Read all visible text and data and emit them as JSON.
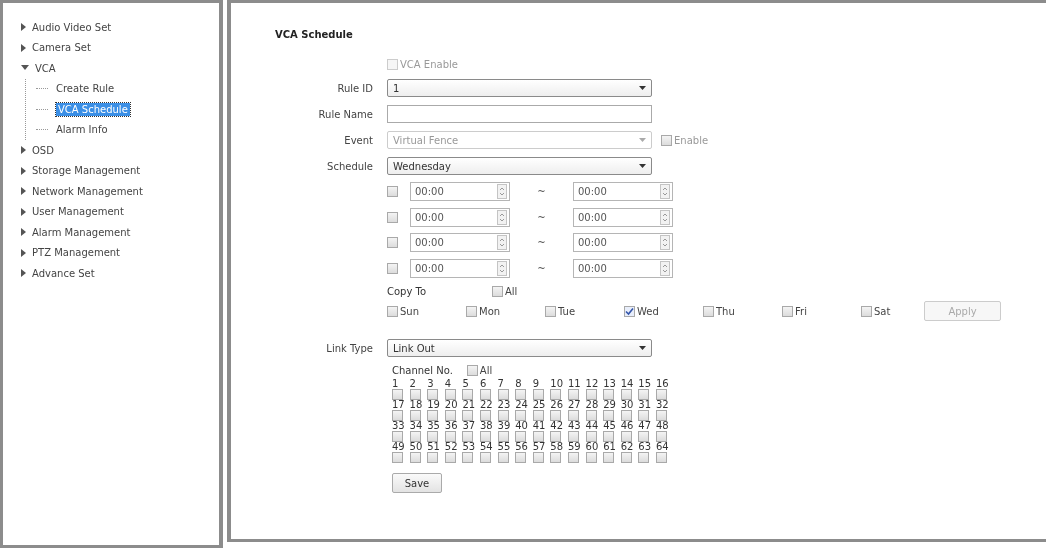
{
  "sidebar": {
    "items": [
      {
        "label": "Audio Video Set",
        "expanded": false
      },
      {
        "label": "Camera Set",
        "expanded": false
      },
      {
        "label": "VCA",
        "expanded": true,
        "children": [
          {
            "label": "Create Rule",
            "selected": false
          },
          {
            "label": "VCA Schedule",
            "selected": true
          },
          {
            "label": "Alarm Info",
            "selected": false
          }
        ]
      },
      {
        "label": "OSD",
        "expanded": false
      },
      {
        "label": "Storage Management",
        "expanded": false
      },
      {
        "label": "Network Management",
        "expanded": false
      },
      {
        "label": "User Management",
        "expanded": false
      },
      {
        "label": "Alarm Management",
        "expanded": false
      },
      {
        "label": "PTZ Management",
        "expanded": false
      },
      {
        "label": "Advance Set",
        "expanded": false
      }
    ]
  },
  "page": {
    "title": "VCA Schedule",
    "vca_enable": {
      "label": "VCA Enable",
      "checked": false,
      "disabled": true
    },
    "rule_id": {
      "label": "Rule ID",
      "value": "1"
    },
    "rule_name": {
      "label": "Rule Name"
    },
    "event": {
      "label": "Event",
      "value": "Virtual Fence",
      "disabled": true,
      "enable": {
        "label": "Enable",
        "checked": false
      }
    },
    "schedule": {
      "label": "Schedule",
      "value": "Wednesday"
    },
    "time_rows": [
      {
        "checked": false,
        "start": "00:00",
        "separator": "~",
        "end": "00:00"
      },
      {
        "checked": false,
        "start": "00:00",
        "separator": "~",
        "end": "00:00"
      },
      {
        "checked": false,
        "start": "00:00",
        "separator": "~",
        "end": "00:00"
      },
      {
        "checked": false,
        "start": "00:00",
        "separator": "~",
        "end": "00:00"
      }
    ],
    "copy_to": {
      "label": "Copy To",
      "all": {
        "label": "All",
        "checked": false
      },
      "days": [
        {
          "label": "Sun",
          "checked": false
        },
        {
          "label": "Mon",
          "checked": false
        },
        {
          "label": "Tue",
          "checked": false
        },
        {
          "label": "Wed",
          "checked": true
        },
        {
          "label": "Thu",
          "checked": false
        },
        {
          "label": "Fri",
          "checked": false
        },
        {
          "label": "Sat",
          "checked": false
        }
      ],
      "apply": {
        "label": "Apply",
        "disabled": true
      }
    },
    "link_type": {
      "label": "Link Type",
      "value": "Link Out"
    },
    "channels": {
      "label": "Channel No.",
      "all": {
        "label": "All",
        "checked": false
      },
      "items": [
        {
          "label": "1",
          "checked": false
        },
        {
          "label": "2",
          "checked": false
        },
        {
          "label": "3",
          "checked": false
        },
        {
          "label": "4",
          "checked": false
        },
        {
          "label": "5",
          "checked": false
        },
        {
          "label": "6",
          "checked": false
        },
        {
          "label": "7",
          "checked": false
        },
        {
          "label": "8",
          "checked": false
        },
        {
          "label": "9",
          "checked": false
        },
        {
          "label": "10",
          "checked": false
        },
        {
          "label": "11",
          "checked": false
        },
        {
          "label": "12",
          "checked": false
        },
        {
          "label": "13",
          "checked": false
        },
        {
          "label": "14",
          "checked": false
        },
        {
          "label": "15",
          "checked": false
        },
        {
          "label": "16",
          "checked": false
        },
        {
          "label": "17",
          "checked": false
        },
        {
          "label": "18",
          "checked": false
        },
        {
          "label": "19",
          "checked": false
        },
        {
          "label": "20",
          "checked": false
        },
        {
          "label": "21",
          "checked": false
        },
        {
          "label": "22",
          "checked": false
        },
        {
          "label": "23",
          "checked": false
        },
        {
          "label": "24",
          "checked": false
        },
        {
          "label": "25",
          "checked": false
        },
        {
          "label": "26",
          "checked": false
        },
        {
          "label": "27",
          "checked": false
        },
        {
          "label": "28",
          "checked": false
        },
        {
          "label": "29",
          "checked": false
        },
        {
          "label": "30",
          "checked": false
        },
        {
          "label": "31",
          "checked": false
        },
        {
          "label": "32",
          "checked": false
        },
        {
          "label": "33",
          "checked": false
        },
        {
          "label": "34",
          "checked": false
        },
        {
          "label": "35",
          "checked": false
        },
        {
          "label": "36",
          "checked": false
        },
        {
          "label": "37",
          "checked": false
        },
        {
          "label": "38",
          "checked": false
        },
        {
          "label": "39",
          "checked": false
        },
        {
          "label": "40",
          "checked": false
        },
        {
          "label": "41",
          "checked": false
        },
        {
          "label": "42",
          "checked": false
        },
        {
          "label": "43",
          "checked": false
        },
        {
          "label": "44",
          "checked": false
        },
        {
          "label": "45",
          "checked": false
        },
        {
          "label": "46",
          "checked": false
        },
        {
          "label": "47",
          "checked": false
        },
        {
          "label": "48",
          "checked": false
        },
        {
          "label": "49",
          "checked": false
        },
        {
          "label": "50",
          "checked": false
        },
        {
          "label": "51",
          "checked": false
        },
        {
          "label": "52",
          "checked": false
        },
        {
          "label": "53",
          "checked": false
        },
        {
          "label": "54",
          "checked": false
        },
        {
          "label": "55",
          "checked": false
        },
        {
          "label": "56",
          "checked": false
        },
        {
          "label": "57",
          "checked": false
        },
        {
          "label": "58",
          "checked": false
        },
        {
          "label": "59",
          "checked": false
        },
        {
          "label": "60",
          "checked": false
        },
        {
          "label": "61",
          "checked": false
        },
        {
          "label": "62",
          "checked": false
        },
        {
          "label": "63",
          "checked": false
        },
        {
          "label": "64",
          "checked": false
        }
      ]
    },
    "save": {
      "label": "Save"
    }
  }
}
